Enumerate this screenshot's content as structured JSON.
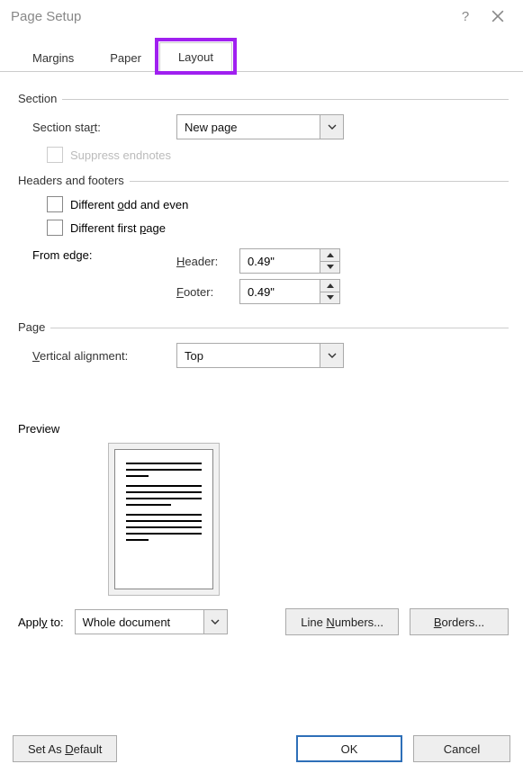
{
  "window": {
    "title": "Page Setup",
    "help": "?",
    "close": "×"
  },
  "tabs": {
    "margins": "Margins",
    "paper": "Paper",
    "layout": "Layout"
  },
  "section": {
    "legend": "Section",
    "start_label_pre": "Section sta",
    "start_label_u": "r",
    "start_label_post": "t:",
    "start_value": "New page",
    "suppress_label": "Suppress endnotes"
  },
  "hf": {
    "legend": "Headers and footers",
    "diff_odd_pre": "Different ",
    "diff_odd_u": "o",
    "diff_odd_post": "dd and even",
    "diff_first_pre": "Different first ",
    "diff_first_u": "p",
    "diff_first_post": "age",
    "from_edge": "From edge:",
    "header_u": "H",
    "header_post": "eader:",
    "header_val": "0.49\"",
    "footer_u": "F",
    "footer_post": "ooter:",
    "footer_val": "0.49\""
  },
  "page": {
    "legend": "Page",
    "valign_u": "V",
    "valign_post": "ertical alignment:",
    "valign_val": "Top"
  },
  "preview": {
    "legend": "Preview"
  },
  "apply": {
    "label_pre": "Appl",
    "label_u": "y",
    "label_post": " to:",
    "value": "Whole document",
    "line_numbers_pre": "Line ",
    "line_numbers_u": "N",
    "line_numbers_post": "umbers...",
    "borders_u": "B",
    "borders_post": "orders..."
  },
  "footer": {
    "default_pre": "Set As ",
    "default_u": "D",
    "default_post": "efault",
    "ok": "OK",
    "cancel": "Cancel"
  }
}
